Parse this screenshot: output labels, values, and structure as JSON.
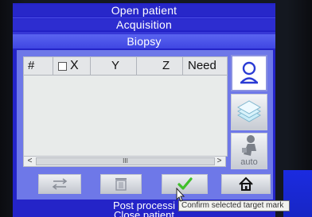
{
  "menu": {
    "open_patient": "Open patient",
    "acquisition": "Acquisition",
    "biopsy": "Biopsy",
    "post_processing": "Post processi",
    "close_patient": "Close patient"
  },
  "table": {
    "columns": [
      "#",
      "X",
      "Y",
      "Z",
      "Need"
    ],
    "rows": []
  },
  "side_buttons": {
    "patient_icon": "patient-position-icon",
    "stack_icon": "image-stack-icon",
    "auto_label": "auto"
  },
  "scrollbar": {
    "left_arrow": "<",
    "right_arrow": ">",
    "thumb_grip": "III"
  },
  "actions": {
    "swap_icon": "swap-arrows-icon",
    "delete_icon": "trash-icon",
    "confirm_icon": "checkmark-icon",
    "home_icon": "home-icon"
  },
  "tooltip": {
    "text": "Confirm selected target mark"
  },
  "colors": {
    "screen_blue": "#2424c8",
    "panel_blue": "#6e78e8",
    "confirm_green": "#3fbf2a"
  }
}
